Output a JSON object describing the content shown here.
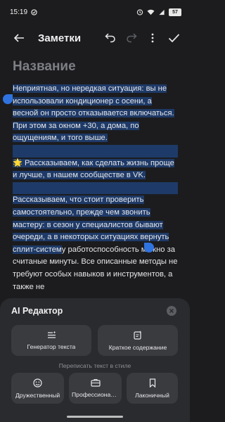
{
  "status_bar": {
    "time": "15:19",
    "battery": "57"
  },
  "toolbar": {
    "title": "Заметки"
  },
  "note": {
    "title_placeholder": "Название",
    "paragraph1": "Неприятная, но нередкая ситуация: вы не использовали кондиционер с осени, а весной он просто отказывается включаться. При этом за окном +30, а дома, по ощущениям, и того выше.",
    "paragraph2_emoji": "🌟",
    "paragraph2_text": " Рассказываем, как сделать жизнь проще и лучше, в нашем сообществе в VK.",
    "paragraph3_selected": "Рассказываем, что стоит проверить самостоятельно, прежде чем звонить мастеру: в сезон у специалистов бывают очереди, а в некоторых ситуациях вернуть сплит-систем",
    "paragraph3_rest": "у работоспособность можно за считаные минуты. Все описанные методы не требуют особых навыков и инструментов, а также не"
  },
  "ai_editor": {
    "title": "AI Редактор",
    "actions": [
      {
        "label": "Генератор текста",
        "icon": "text-generator-icon"
      },
      {
        "label": "Краткое содержание",
        "icon": "summary-icon"
      }
    ],
    "rewrite_label": "Переписать текст в стиле",
    "styles": [
      {
        "label": "Дружественный",
        "icon": "smiley-icon"
      },
      {
        "label": "Профессиональ...",
        "icon": "briefcase-icon"
      },
      {
        "label": "Лаконичный",
        "icon": "bookmark-icon"
      }
    ]
  },
  "colors": {
    "background": "#1c1c1e",
    "selection": "#1e3a68",
    "selection_handle": "#2f73e0",
    "sheet": "#2a2b2e",
    "card": "#3a3b3f"
  }
}
